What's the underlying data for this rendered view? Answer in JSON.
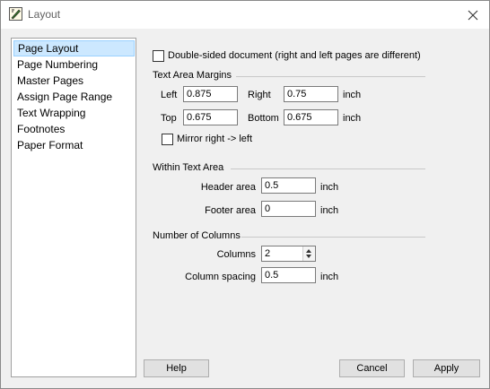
{
  "window": {
    "title": "Layout"
  },
  "sidebar": {
    "items": [
      {
        "label": "Page Layout",
        "selected": true
      },
      {
        "label": "Page Numbering"
      },
      {
        "label": "Master Pages"
      },
      {
        "label": "Assign Page Range"
      },
      {
        "label": "Text Wrapping"
      },
      {
        "label": "Footnotes"
      },
      {
        "label": "Paper Format"
      }
    ]
  },
  "page_layout": {
    "double_sided": {
      "label": "Double-sided document (right and left pages are different)",
      "checked": false
    },
    "text_area_margins": {
      "heading": "Text Area Margins",
      "left_label": "Left",
      "left_value": "0.875",
      "right_label": "Right",
      "right_value": "0.75",
      "top_label": "Top",
      "top_value": "0.675",
      "bottom_label": "Bottom",
      "bottom_value": "0.675",
      "unit": "inch",
      "mirror": {
        "label": "Mirror right -> left",
        "checked": false
      }
    },
    "within_text_area": {
      "heading": "Within Text Area",
      "header_label": "Header area",
      "header_value": "0.5",
      "footer_label": "Footer area",
      "footer_value": "0",
      "unit": "inch"
    },
    "number_of_columns": {
      "heading": "Number of Columns",
      "columns_label": "Columns",
      "columns_value": "2",
      "spacing_label": "Column spacing",
      "spacing_value": "0.5",
      "unit": "inch"
    }
  },
  "buttons": {
    "help": "Help",
    "cancel": "Cancel",
    "apply": "Apply"
  },
  "icons": {
    "app": "document-pen-icon",
    "close": "close-icon"
  },
  "colors": {
    "selection_bg": "#cce8ff",
    "selection_border": "#99d1ff"
  }
}
